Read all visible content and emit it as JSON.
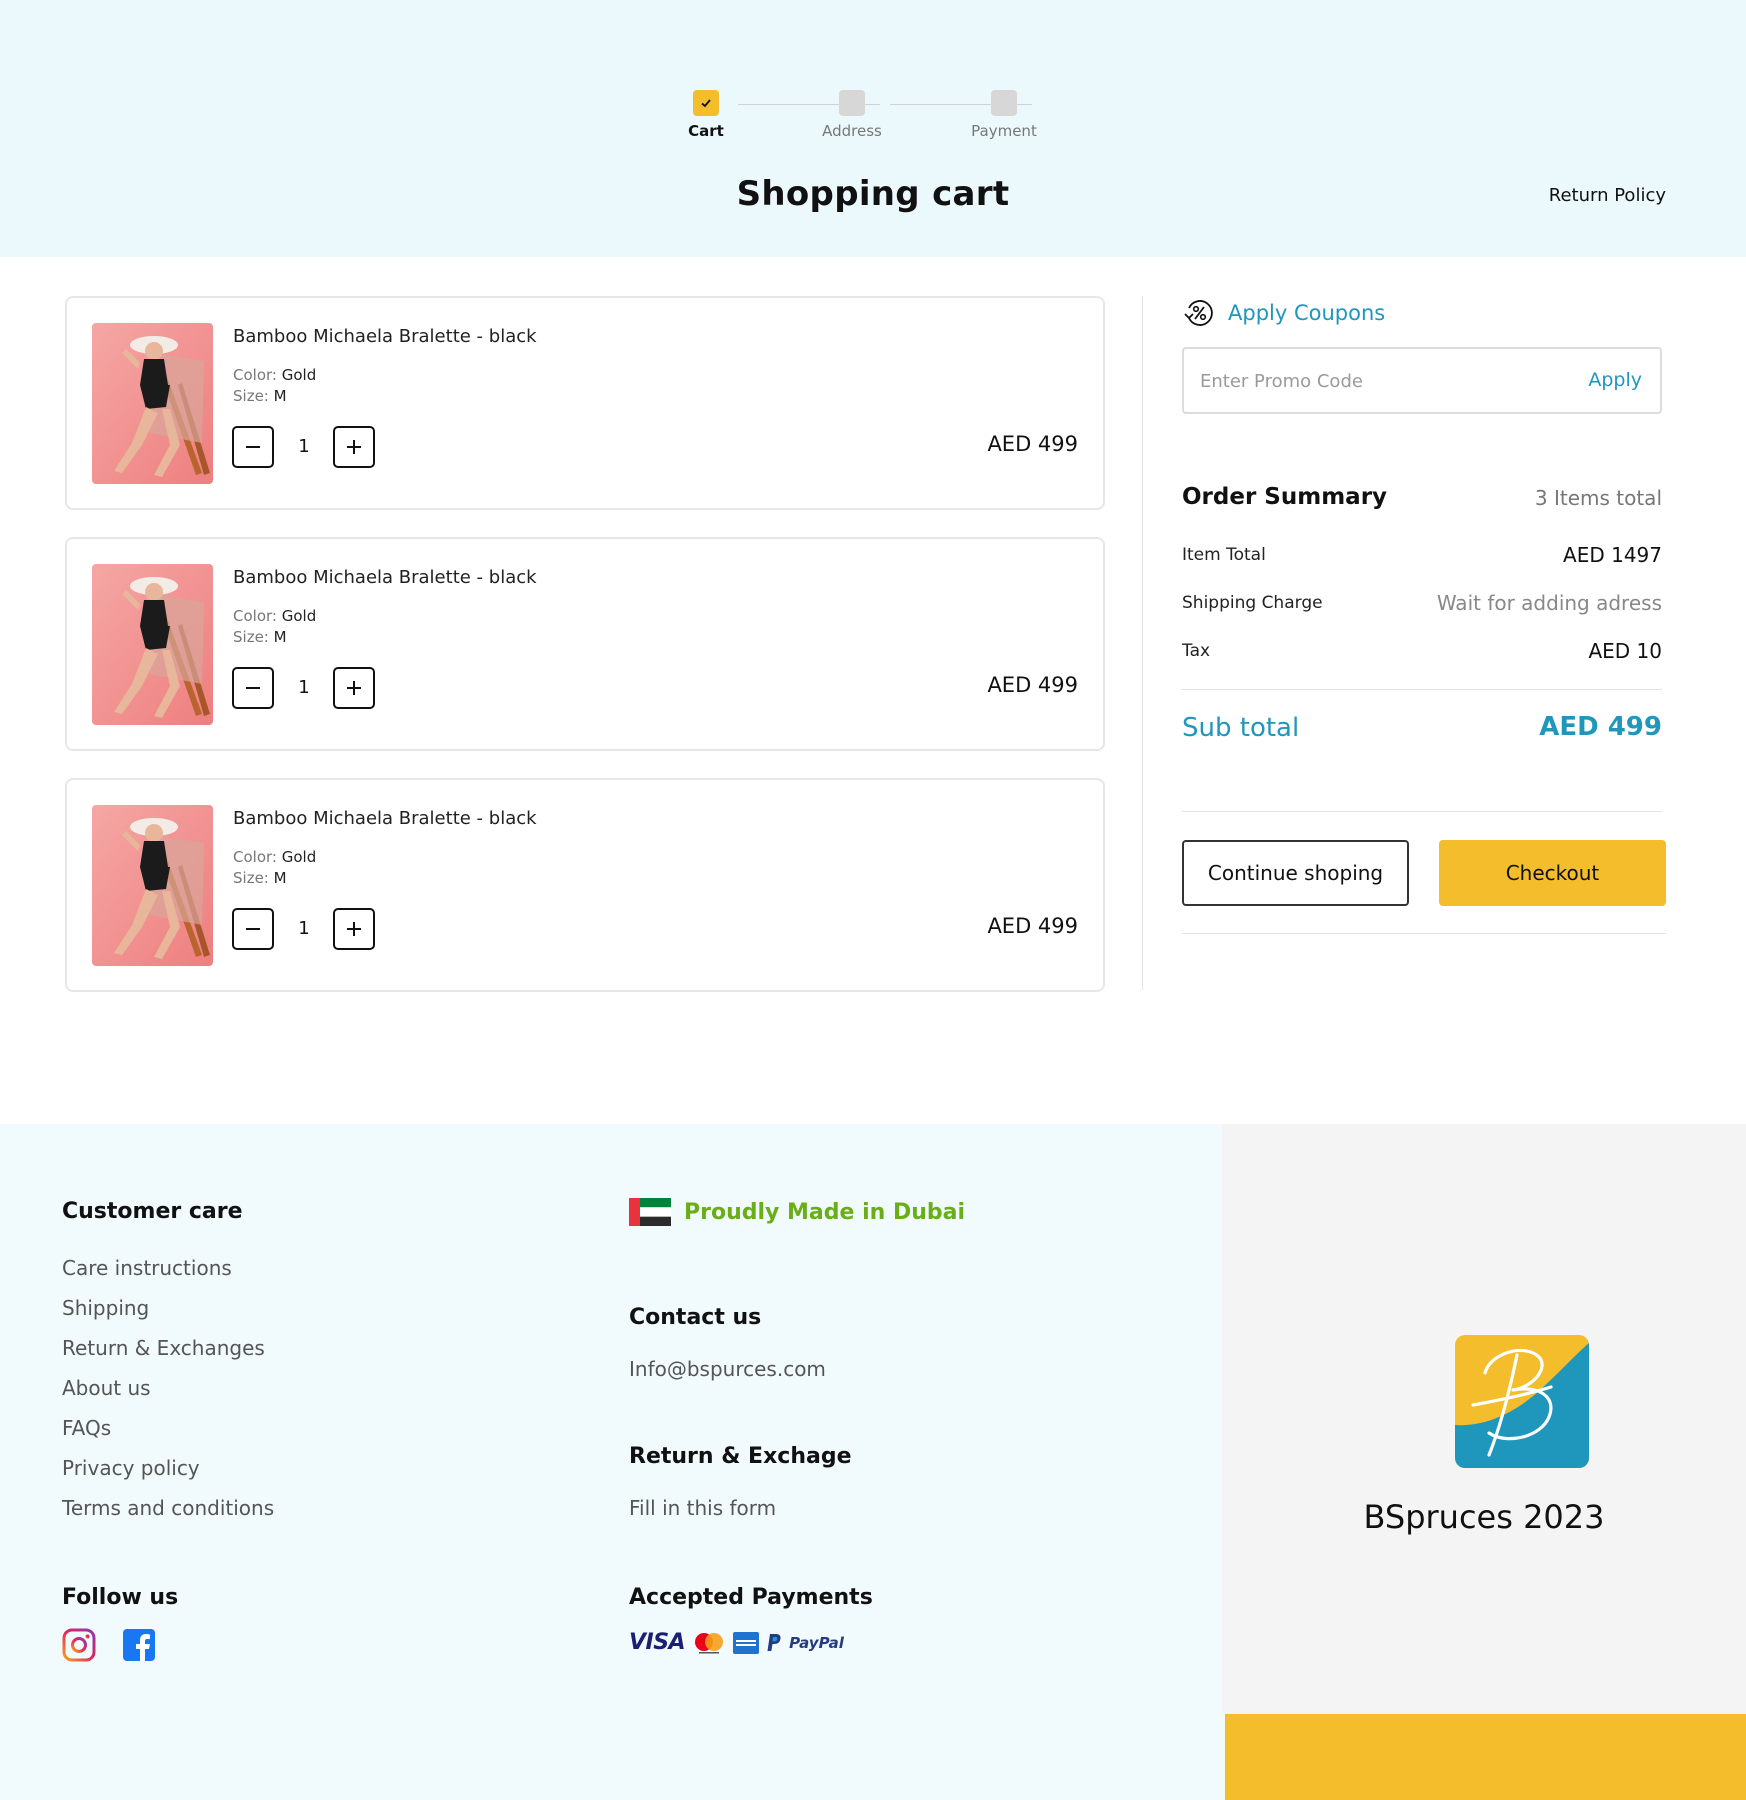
{
  "steps": [
    {
      "label": "Cart",
      "state": "done"
    },
    {
      "label": "Address",
      "state": "pending"
    },
    {
      "label": "Payment",
      "state": "pending"
    }
  ],
  "page_title": "Shopping cart",
  "return_policy_link": "Return Policy",
  "cart": {
    "items": [
      {
        "name": "Bamboo Michaela Bralette - black",
        "color_label": "Color:",
        "color": "Gold",
        "size_label": "Size:",
        "size": "M",
        "quantity": "1",
        "price": "AED 499"
      },
      {
        "name": "Bamboo Michaela Bralette - black",
        "color_label": "Color:",
        "color": "Gold",
        "size_label": "Size:",
        "size": "M",
        "quantity": "1",
        "price": "AED 499"
      },
      {
        "name": "Bamboo Michaela Bralette - black",
        "color_label": "Color:",
        "color": "Gold",
        "size_label": "Size:",
        "size": "M",
        "quantity": "1",
        "price": "AED 499"
      }
    ]
  },
  "coupon": {
    "title": "Apply Coupons",
    "placeholder": "Enter Promo Code",
    "apply_label": "Apply"
  },
  "summary": {
    "title": "Order Summary",
    "count": "3 Items total",
    "item_total_label": "Item Total",
    "item_total": "AED 1497",
    "shipping_label": "Shipping Charge",
    "shipping": "Wait for adding adress",
    "tax_label": "Tax",
    "tax": "AED 10",
    "subtotal_label": "Sub total",
    "subtotal": "AED 499"
  },
  "actions": {
    "continue_label": "Continue shoping",
    "checkout_label": "Checkout"
  },
  "footer": {
    "customer_care_title": "Customer care",
    "customer_care_links": [
      "Care instructions",
      "Shipping",
      "Return & Exchanges",
      "About us",
      "FAQs",
      "Privacy policy",
      "Terms and conditions"
    ],
    "follow_title": "Follow us",
    "social_icons": [
      "instagram-icon",
      "facebook-icon"
    ],
    "made_in": "Proudly Made in Dubai",
    "contact_title": "Contact us",
    "contact_email": "Info@bspurces.com",
    "return_title": "Return & Exchage",
    "return_link": "Fill in this form",
    "payments_title": "Accepted Payments",
    "payment_logos": {
      "visa": "VISA",
      "paypal": "PayPal"
    },
    "brand_name": "BSpruces 2023"
  },
  "colors": {
    "accent_yellow": "#f3bd2b",
    "accent_blue": "#1f97bd",
    "hero_bg": "#ebf8fc",
    "made_in_green": "#6aae16"
  }
}
